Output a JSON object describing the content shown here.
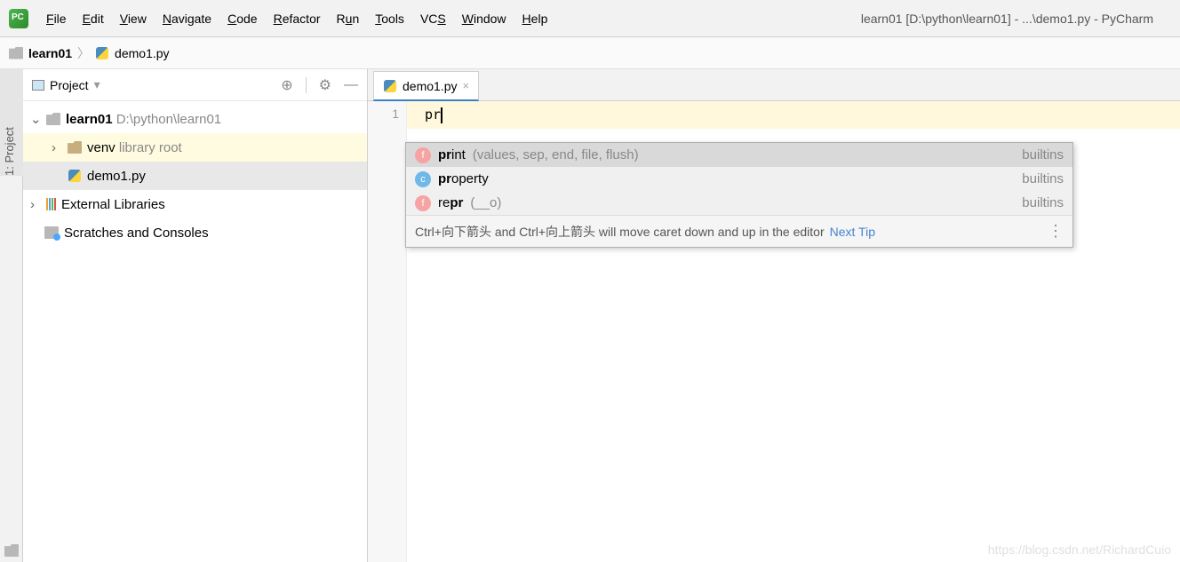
{
  "window_title": "learn01 [D:\\python\\learn01] - ...\\demo1.py - PyCharm",
  "menu": [
    "File",
    "Edit",
    "View",
    "Navigate",
    "Code",
    "Refactor",
    "Run",
    "Tools",
    "VCS",
    "Window",
    "Help"
  ],
  "breadcrumb": {
    "project": "learn01",
    "file": "demo1.py"
  },
  "project_panel": {
    "title": "Project",
    "tree": {
      "root": {
        "name": "learn01",
        "path": "D:\\python\\learn01"
      },
      "venv": {
        "name": "venv",
        "hint": "library root"
      },
      "file": "demo1.py",
      "external": "External Libraries",
      "scratch": "Scratches and Consoles"
    }
  },
  "sidebar_tab": "1: Project",
  "editor": {
    "tab_name": "demo1.py",
    "line_number": "1",
    "typed": "pr"
  },
  "completion": {
    "items": [
      {
        "kind": "f",
        "prefix": "pr",
        "rest": "int",
        "params": "(values, sep, end, file, flush)",
        "source": "builtins"
      },
      {
        "kind": "c",
        "prefix": "pr",
        "rest": "operty",
        "params": "",
        "source": "builtins"
      },
      {
        "kind": "f",
        "prefix": "re",
        "rest": "pr",
        "params": "(__o)",
        "source": "builtins"
      }
    ],
    "hint": "Ctrl+向下箭头 and Ctrl+向上箭头 will move caret down and up in the editor",
    "next_tip": "Next Tip"
  },
  "watermark": "https://blog.csdn.net/RichardCuio"
}
